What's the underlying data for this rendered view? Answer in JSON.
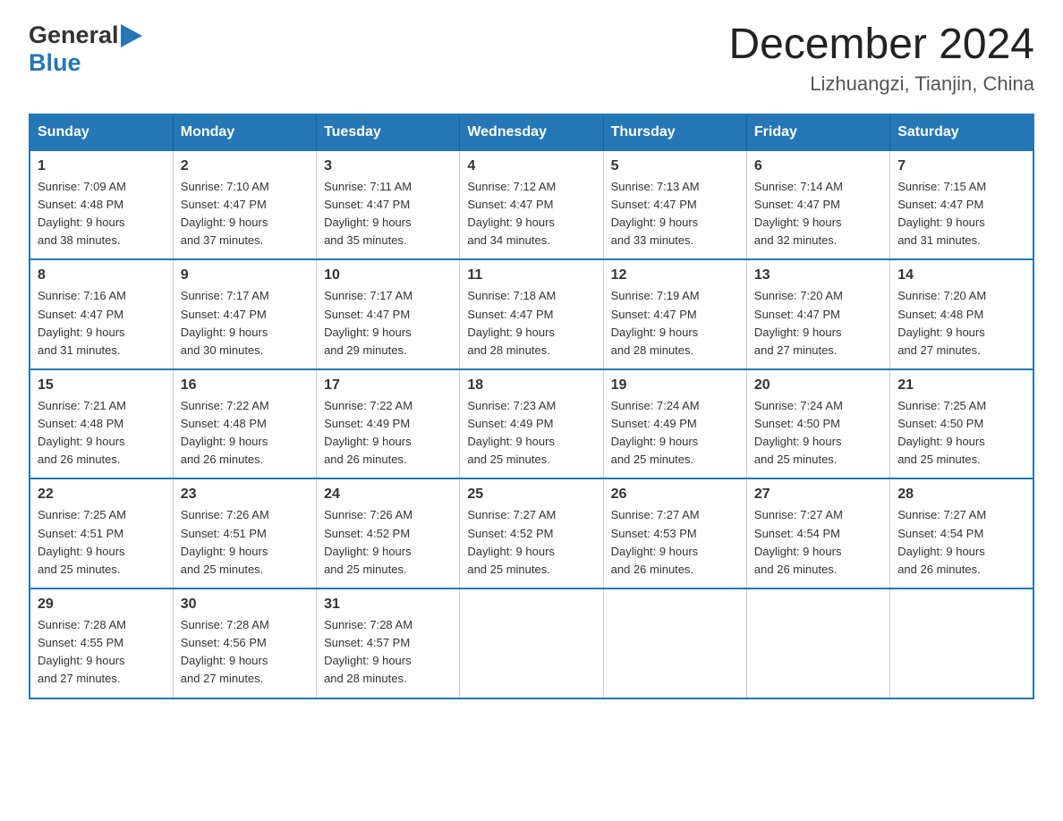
{
  "logo": {
    "text_general": "General",
    "text_blue": "Blue"
  },
  "title": {
    "main": "December 2024",
    "subtitle": "Lizhuangzi, Tianjin, China"
  },
  "weekdays": [
    "Sunday",
    "Monday",
    "Tuesday",
    "Wednesday",
    "Thursday",
    "Friday",
    "Saturday"
  ],
  "weeks": [
    [
      {
        "day": "1",
        "sunrise": "Sunrise: 7:09 AM",
        "sunset": "Sunset: 4:48 PM",
        "daylight": "Daylight: 9 hours and 38 minutes."
      },
      {
        "day": "2",
        "sunrise": "Sunrise: 7:10 AM",
        "sunset": "Sunset: 4:47 PM",
        "daylight": "Daylight: 9 hours and 37 minutes."
      },
      {
        "day": "3",
        "sunrise": "Sunrise: 7:11 AM",
        "sunset": "Sunset: 4:47 PM",
        "daylight": "Daylight: 9 hours and 35 minutes."
      },
      {
        "day": "4",
        "sunrise": "Sunrise: 7:12 AM",
        "sunset": "Sunset: 4:47 PM",
        "daylight": "Daylight: 9 hours and 34 minutes."
      },
      {
        "day": "5",
        "sunrise": "Sunrise: 7:13 AM",
        "sunset": "Sunset: 4:47 PM",
        "daylight": "Daylight: 9 hours and 33 minutes."
      },
      {
        "day": "6",
        "sunrise": "Sunrise: 7:14 AM",
        "sunset": "Sunset: 4:47 PM",
        "daylight": "Daylight: 9 hours and 32 minutes."
      },
      {
        "day": "7",
        "sunrise": "Sunrise: 7:15 AM",
        "sunset": "Sunset: 4:47 PM",
        "daylight": "Daylight: 9 hours and 31 minutes."
      }
    ],
    [
      {
        "day": "8",
        "sunrise": "Sunrise: 7:16 AM",
        "sunset": "Sunset: 4:47 PM",
        "daylight": "Daylight: 9 hours and 31 minutes."
      },
      {
        "day": "9",
        "sunrise": "Sunrise: 7:17 AM",
        "sunset": "Sunset: 4:47 PM",
        "daylight": "Daylight: 9 hours and 30 minutes."
      },
      {
        "day": "10",
        "sunrise": "Sunrise: 7:17 AM",
        "sunset": "Sunset: 4:47 PM",
        "daylight": "Daylight: 9 hours and 29 minutes."
      },
      {
        "day": "11",
        "sunrise": "Sunrise: 7:18 AM",
        "sunset": "Sunset: 4:47 PM",
        "daylight": "Daylight: 9 hours and 28 minutes."
      },
      {
        "day": "12",
        "sunrise": "Sunrise: 7:19 AM",
        "sunset": "Sunset: 4:47 PM",
        "daylight": "Daylight: 9 hours and 28 minutes."
      },
      {
        "day": "13",
        "sunrise": "Sunrise: 7:20 AM",
        "sunset": "Sunset: 4:47 PM",
        "daylight": "Daylight: 9 hours and 27 minutes."
      },
      {
        "day": "14",
        "sunrise": "Sunrise: 7:20 AM",
        "sunset": "Sunset: 4:48 PM",
        "daylight": "Daylight: 9 hours and 27 minutes."
      }
    ],
    [
      {
        "day": "15",
        "sunrise": "Sunrise: 7:21 AM",
        "sunset": "Sunset: 4:48 PM",
        "daylight": "Daylight: 9 hours and 26 minutes."
      },
      {
        "day": "16",
        "sunrise": "Sunrise: 7:22 AM",
        "sunset": "Sunset: 4:48 PM",
        "daylight": "Daylight: 9 hours and 26 minutes."
      },
      {
        "day": "17",
        "sunrise": "Sunrise: 7:22 AM",
        "sunset": "Sunset: 4:49 PM",
        "daylight": "Daylight: 9 hours and 26 minutes."
      },
      {
        "day": "18",
        "sunrise": "Sunrise: 7:23 AM",
        "sunset": "Sunset: 4:49 PM",
        "daylight": "Daylight: 9 hours and 25 minutes."
      },
      {
        "day": "19",
        "sunrise": "Sunrise: 7:24 AM",
        "sunset": "Sunset: 4:49 PM",
        "daylight": "Daylight: 9 hours and 25 minutes."
      },
      {
        "day": "20",
        "sunrise": "Sunrise: 7:24 AM",
        "sunset": "Sunset: 4:50 PM",
        "daylight": "Daylight: 9 hours and 25 minutes."
      },
      {
        "day": "21",
        "sunrise": "Sunrise: 7:25 AM",
        "sunset": "Sunset: 4:50 PM",
        "daylight": "Daylight: 9 hours and 25 minutes."
      }
    ],
    [
      {
        "day": "22",
        "sunrise": "Sunrise: 7:25 AM",
        "sunset": "Sunset: 4:51 PM",
        "daylight": "Daylight: 9 hours and 25 minutes."
      },
      {
        "day": "23",
        "sunrise": "Sunrise: 7:26 AM",
        "sunset": "Sunset: 4:51 PM",
        "daylight": "Daylight: 9 hours and 25 minutes."
      },
      {
        "day": "24",
        "sunrise": "Sunrise: 7:26 AM",
        "sunset": "Sunset: 4:52 PM",
        "daylight": "Daylight: 9 hours and 25 minutes."
      },
      {
        "day": "25",
        "sunrise": "Sunrise: 7:27 AM",
        "sunset": "Sunset: 4:52 PM",
        "daylight": "Daylight: 9 hours and 25 minutes."
      },
      {
        "day": "26",
        "sunrise": "Sunrise: 7:27 AM",
        "sunset": "Sunset: 4:53 PM",
        "daylight": "Daylight: 9 hours and 26 minutes."
      },
      {
        "day": "27",
        "sunrise": "Sunrise: 7:27 AM",
        "sunset": "Sunset: 4:54 PM",
        "daylight": "Daylight: 9 hours and 26 minutes."
      },
      {
        "day": "28",
        "sunrise": "Sunrise: 7:27 AM",
        "sunset": "Sunset: 4:54 PM",
        "daylight": "Daylight: 9 hours and 26 minutes."
      }
    ],
    [
      {
        "day": "29",
        "sunrise": "Sunrise: 7:28 AM",
        "sunset": "Sunset: 4:55 PM",
        "daylight": "Daylight: 9 hours and 27 minutes."
      },
      {
        "day": "30",
        "sunrise": "Sunrise: 7:28 AM",
        "sunset": "Sunset: 4:56 PM",
        "daylight": "Daylight: 9 hours and 27 minutes."
      },
      {
        "day": "31",
        "sunrise": "Sunrise: 7:28 AM",
        "sunset": "Sunset: 4:57 PM",
        "daylight": "Daylight: 9 hours and 28 minutes."
      },
      null,
      null,
      null,
      null
    ]
  ]
}
